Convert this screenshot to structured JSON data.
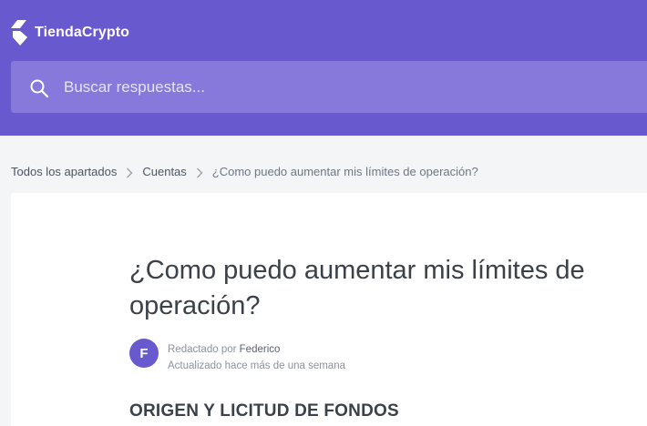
{
  "brand": {
    "name": "TiendaCrypto",
    "logo_icon": "diamond-logo-icon",
    "header_color": "#6859cf",
    "search_color": "#8679db"
  },
  "search": {
    "placeholder": "Buscar respuestas...",
    "value": "",
    "icon": "search-icon"
  },
  "breadcrumb": {
    "items": [
      {
        "label": "Todos los apartados"
      },
      {
        "label": "Cuentas"
      },
      {
        "label": "¿Como puedo aumentar mis límites de operación?"
      }
    ],
    "separator_icon": "chevron-right-icon"
  },
  "article": {
    "title": "¿Como puedo aumentar mis límites de operación?",
    "author": {
      "initial": "F",
      "prefix": "Redactado por",
      "name": "Federico"
    },
    "updated": "Actualizado hace más de una semana",
    "section_heading": "ORIGEN Y LICITUD DE FONDOS"
  }
}
